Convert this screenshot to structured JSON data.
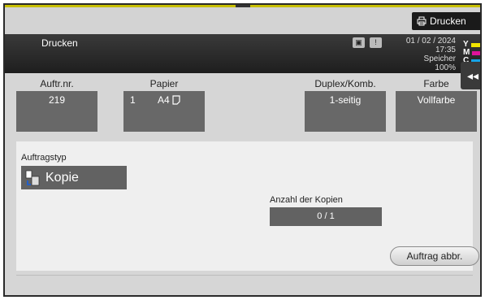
{
  "topbar": {
    "print_button_label": "Drucken"
  },
  "header": {
    "title": "Drucken",
    "date": "01 / 02 / 2024",
    "time": "17:35",
    "memory_label": "Speicher",
    "memory_value": "100%",
    "toner": [
      {
        "label": "Y",
        "color": "#f1e400"
      },
      {
        "label": "M",
        "color": "#e0129a"
      },
      {
        "label": "C",
        "color": "#16a3e6"
      }
    ]
  },
  "side_tab": {
    "icon": "double-chevron-left-icon",
    "glyph": "◂◂"
  },
  "job_info": {
    "job_number": {
      "label": "Auftr.nr.",
      "value": "219"
    },
    "paper": {
      "label": "Papier",
      "tray": "1",
      "size": "A4"
    },
    "duplex": {
      "label": "Duplex/Komb.",
      "value": "1-seitig"
    },
    "color": {
      "label": "Farbe",
      "value": "Vollfarbe"
    }
  },
  "job_type": {
    "label": "Auftragstyp",
    "value": "Kopie"
  },
  "copies": {
    "label": "Anzahl der Kopien",
    "value": "0  /  1"
  },
  "cancel_button_label": "Auftrag abbr."
}
